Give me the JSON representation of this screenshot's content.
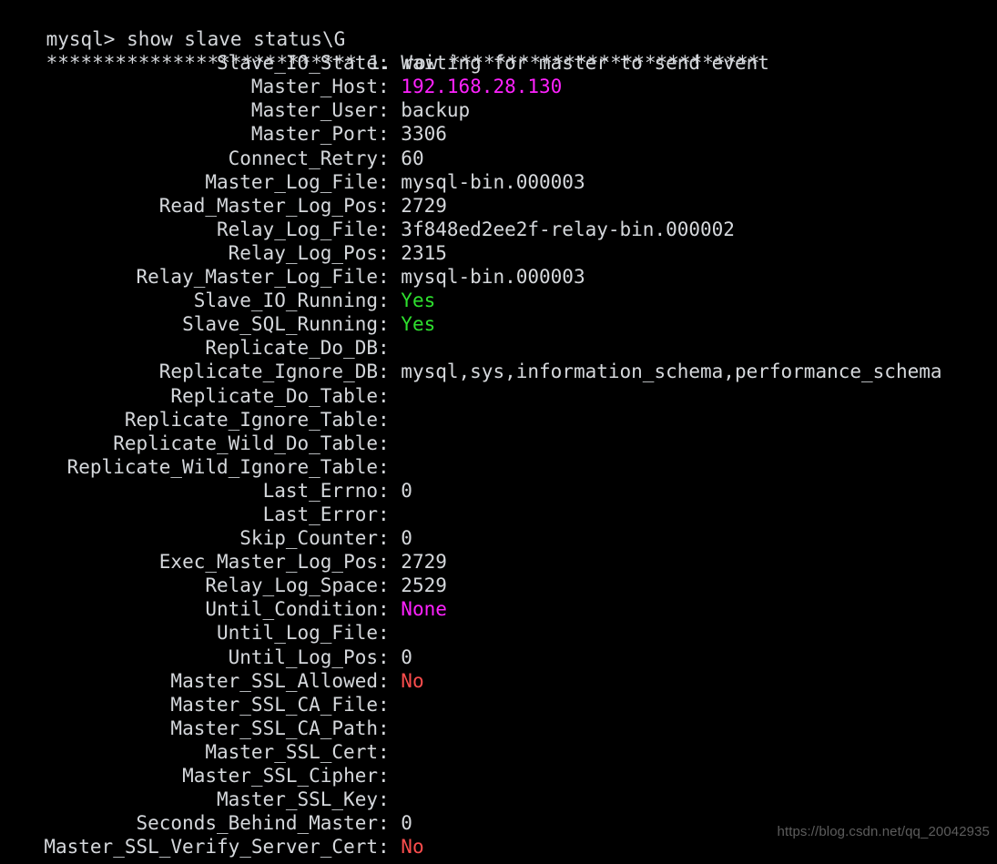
{
  "terminal": {
    "prompt_line": "mysql> show slave status\\G",
    "row_separator": "*************************** 1. row ***************************",
    "colors": {
      "background": "#000000",
      "foreground": "#d5d8dc",
      "magenta": "#ff22ff",
      "green": "#2ee02e",
      "red": "#fa4d4d",
      "watermark": "#5d5d5d"
    },
    "separator": ": ",
    "rows": [
      {
        "label": "Slave_IO_State",
        "value": "Waiting for master to send event",
        "color": "default"
      },
      {
        "label": "Master_Host",
        "value": "192.168.28.130",
        "color": "magenta"
      },
      {
        "label": "Master_User",
        "value": "backup",
        "color": "default"
      },
      {
        "label": "Master_Port",
        "value": "3306",
        "color": "default"
      },
      {
        "label": "Connect_Retry",
        "value": "60",
        "color": "default"
      },
      {
        "label": "Master_Log_File",
        "value": "mysql-bin.000003",
        "color": "default"
      },
      {
        "label": "Read_Master_Log_Pos",
        "value": "2729",
        "color": "default"
      },
      {
        "label": "Relay_Log_File",
        "value": "3f848ed2ee2f-relay-bin.000002",
        "color": "default"
      },
      {
        "label": "Relay_Log_Pos",
        "value": "2315",
        "color": "default"
      },
      {
        "label": "Relay_Master_Log_File",
        "value": "mysql-bin.000003",
        "color": "default"
      },
      {
        "label": "Slave_IO_Running",
        "value": "Yes",
        "color": "green"
      },
      {
        "label": "Slave_SQL_Running",
        "value": "Yes",
        "color": "green"
      },
      {
        "label": "Replicate_Do_DB",
        "value": "",
        "color": "default"
      },
      {
        "label": "Replicate_Ignore_DB",
        "value": "mysql,sys,information_schema,performance_schema",
        "color": "default"
      },
      {
        "label": "Replicate_Do_Table",
        "value": "",
        "color": "default"
      },
      {
        "label": "Replicate_Ignore_Table",
        "value": "",
        "color": "default"
      },
      {
        "label": "Replicate_Wild_Do_Table",
        "value": "",
        "color": "default"
      },
      {
        "label": "Replicate_Wild_Ignore_Table",
        "value": "",
        "color": "default"
      },
      {
        "label": "Last_Errno",
        "value": "0",
        "color": "default"
      },
      {
        "label": "Last_Error",
        "value": "",
        "color": "default"
      },
      {
        "label": "Skip_Counter",
        "value": "0",
        "color": "default"
      },
      {
        "label": "Exec_Master_Log_Pos",
        "value": "2729",
        "color": "default"
      },
      {
        "label": "Relay_Log_Space",
        "value": "2529",
        "color": "default"
      },
      {
        "label": "Until_Condition",
        "value": "None",
        "color": "magenta"
      },
      {
        "label": "Until_Log_File",
        "value": "",
        "color": "default"
      },
      {
        "label": "Until_Log_Pos",
        "value": "0",
        "color": "default"
      },
      {
        "label": "Master_SSL_Allowed",
        "value": "No",
        "color": "red"
      },
      {
        "label": "Master_SSL_CA_File",
        "value": "",
        "color": "default"
      },
      {
        "label": "Master_SSL_CA_Path",
        "value": "",
        "color": "default"
      },
      {
        "label": "Master_SSL_Cert",
        "value": "",
        "color": "default"
      },
      {
        "label": "Master_SSL_Cipher",
        "value": "",
        "color": "default"
      },
      {
        "label": "Master_SSL_Key",
        "value": "",
        "color": "default"
      },
      {
        "label": "Seconds_Behind_Master",
        "value": "0",
        "color": "default"
      },
      {
        "label": "Master_SSL_Verify_Server_Cert",
        "value": "No",
        "color": "red"
      }
    ]
  },
  "watermark": {
    "text": "https://blog.csdn.net/qq_20042935"
  }
}
